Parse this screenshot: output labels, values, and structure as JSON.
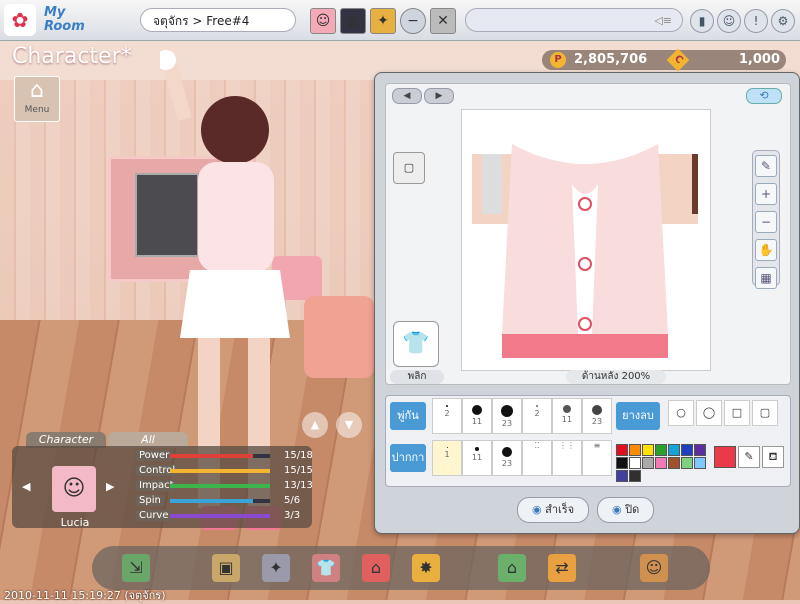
{
  "topbar": {
    "myroom_label": "My\nRoom",
    "location": "จตุจักร > Free#4"
  },
  "title": "Character*",
  "menu_label": "Menu",
  "currency": {
    "coins": "2,805,706",
    "cash": "1,000"
  },
  "editor": {
    "flip_label": "พลิก",
    "view_label": "ด้านหลัง",
    "zoom": "200%",
    "brush_label": "พู่กัน",
    "eraser_label": "ยางลบ",
    "pen_label": "ปากกา",
    "brush_sizes": [
      "2",
      "11",
      "23",
      "2",
      "11",
      "23"
    ],
    "pen_sizes": [
      "1",
      "11",
      "23"
    ],
    "palette": [
      "#e01020",
      "#ff8a00",
      "#ffe000",
      "#2ca02c",
      "#17a2d8",
      "#1f3fbf",
      "#5b2fa0",
      "#111111",
      "#ffffff",
      "#aaaaaa",
      "#f47ab5",
      "#a0522d",
      "#7fd07f",
      "#80c8ff",
      "#4040a0",
      "#303030"
    ],
    "current_color": "#ea3a4a",
    "done_label": "สำเร็จ",
    "close_label": "ปิด"
  },
  "stats": {
    "tab_character": "Character",
    "tab_all": "All",
    "name": "Lucia",
    "items": [
      {
        "label": "Power",
        "value": "15/18",
        "fraction": 0.83,
        "color": "#e0403a"
      },
      {
        "label": "Control",
        "value": "15/15",
        "fraction": 1.0,
        "color": "#f3b531"
      },
      {
        "label": "Impact",
        "value": "13/13",
        "fraction": 1.0,
        "color": "#3cb54a"
      },
      {
        "label": "Spin",
        "value": "5/6",
        "fraction": 0.83,
        "color": "#3aa3d8"
      },
      {
        "label": "Curve",
        "value": "3/3",
        "fraction": 1.0,
        "color": "#8a4ad0"
      }
    ]
  },
  "timestamp": "2010-11-11 15:19:27 (จตุจักร)"
}
